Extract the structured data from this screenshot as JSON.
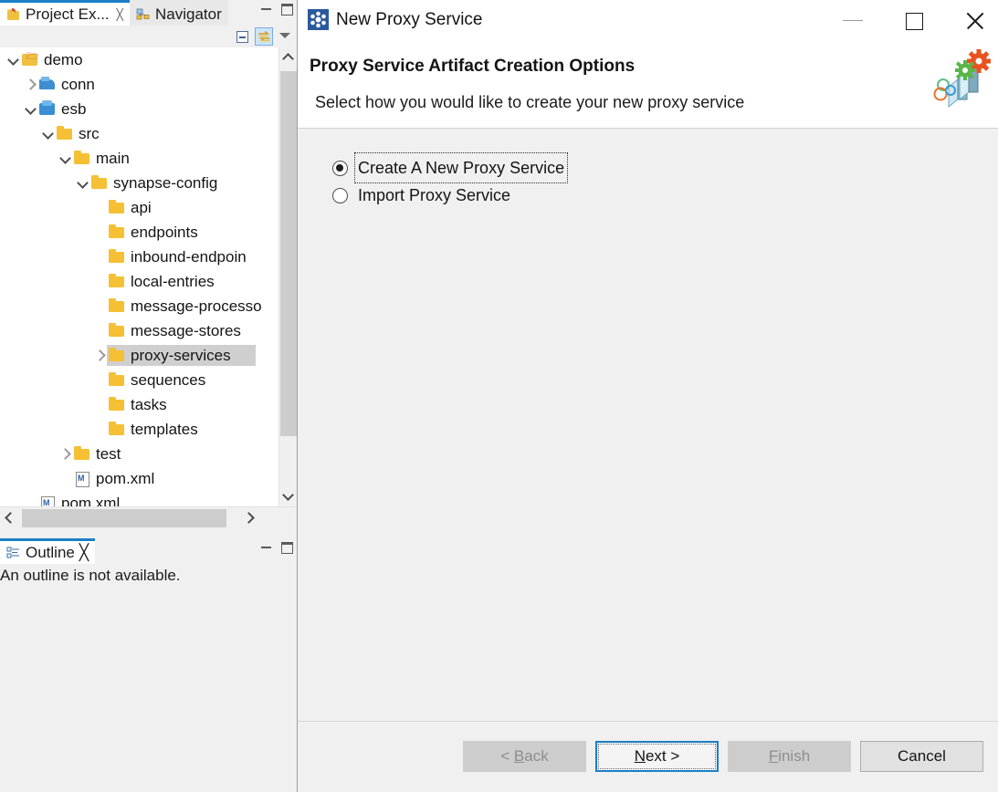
{
  "workbench": {
    "tabs": [
      {
        "label": "Project Ex...",
        "icon": "project-explorer-icon",
        "active": true,
        "closable": true
      },
      {
        "label": "Navigator",
        "icon": "navigator-icon",
        "active": false,
        "closable": false
      }
    ],
    "view_buttons": {
      "minimize": "minimize-view",
      "maximize": "maximize-view",
      "collapse_all": "collapse-all",
      "link_with_editor": "link-with-editor",
      "view_menu": "view-menu"
    },
    "tree": [
      {
        "label": "demo",
        "depth": 0,
        "icon": "project-icon",
        "twisty": "open",
        "selected": false
      },
      {
        "label": "conn",
        "depth": 1,
        "icon": "connector-icon",
        "twisty": "closed",
        "selected": false
      },
      {
        "label": "esb",
        "depth": 1,
        "icon": "esb-icon",
        "twisty": "open",
        "selected": false
      },
      {
        "label": "src",
        "depth": 2,
        "icon": "folder-icon",
        "twisty": "open",
        "selected": false
      },
      {
        "label": "main",
        "depth": 3,
        "icon": "folder-icon",
        "twisty": "open",
        "selected": false
      },
      {
        "label": "synapse-config",
        "depth": 4,
        "icon": "folder-icon",
        "twisty": "open",
        "selected": false
      },
      {
        "label": "api",
        "depth": 5,
        "icon": "folder-icon",
        "twisty": "none",
        "selected": false
      },
      {
        "label": "endpoints",
        "depth": 5,
        "icon": "folder-icon",
        "twisty": "none",
        "selected": false
      },
      {
        "label": "inbound-endpoin",
        "depth": 5,
        "icon": "folder-icon",
        "twisty": "none",
        "selected": false
      },
      {
        "label": "local-entries",
        "depth": 5,
        "icon": "folder-icon",
        "twisty": "none",
        "selected": false
      },
      {
        "label": "message-processo",
        "depth": 5,
        "icon": "folder-icon",
        "twisty": "none",
        "selected": false
      },
      {
        "label": "message-stores",
        "depth": 5,
        "icon": "folder-icon",
        "twisty": "none",
        "selected": false
      },
      {
        "label": "proxy-services",
        "depth": 5,
        "icon": "folder-icon",
        "twisty": "closed",
        "selected": true
      },
      {
        "label": "sequences",
        "depth": 5,
        "icon": "folder-icon",
        "twisty": "none",
        "selected": false
      },
      {
        "label": "tasks",
        "depth": 5,
        "icon": "folder-icon",
        "twisty": "none",
        "selected": false
      },
      {
        "label": "templates",
        "depth": 5,
        "icon": "folder-icon",
        "twisty": "none",
        "selected": false
      },
      {
        "label": "test",
        "depth": 3,
        "icon": "folder-icon",
        "twisty": "closed",
        "selected": false
      },
      {
        "label": "pom.xml",
        "depth": 3,
        "icon": "xml-file-icon",
        "twisty": "none",
        "selected": false
      },
      {
        "label": "pom.xml",
        "depth": 1,
        "icon": "xml-file-icon",
        "twisty": "none",
        "selected": false
      }
    ],
    "outline": {
      "tab_label": "Outline",
      "message": "An outline is not available."
    }
  },
  "dialog": {
    "title": "New Proxy Service",
    "icon": "wso2-molecule-icon",
    "window_controls": {
      "minimize": "minimize-icon",
      "maximize": "maximize-icon",
      "close": "close-icon"
    },
    "header": {
      "title": "Proxy Service Artifact Creation Options",
      "subtitle": "Select how you would like to create your new proxy service",
      "banner_icon": "gears-chart-icon"
    },
    "options": [
      {
        "label": "Create A New Proxy Service",
        "checked": true,
        "focused": true
      },
      {
        "label": "Import Proxy Service",
        "checked": false,
        "focused": false
      }
    ],
    "buttons": [
      {
        "label": "< Back",
        "state": "disabled",
        "mnemonic": "B"
      },
      {
        "label": "Next >",
        "state": "default",
        "mnemonic": "N"
      },
      {
        "label": "Finish",
        "state": "disabled",
        "mnemonic": "F"
      },
      {
        "label": "Cancel",
        "state": "enabled",
        "mnemonic": ""
      }
    ]
  },
  "colors": {
    "accent_blue": "#1a7ec8",
    "selection_gray": "#cfcfcf",
    "dialog_body": "#f0f0f0",
    "folder_yellow": "#f5c033"
  }
}
